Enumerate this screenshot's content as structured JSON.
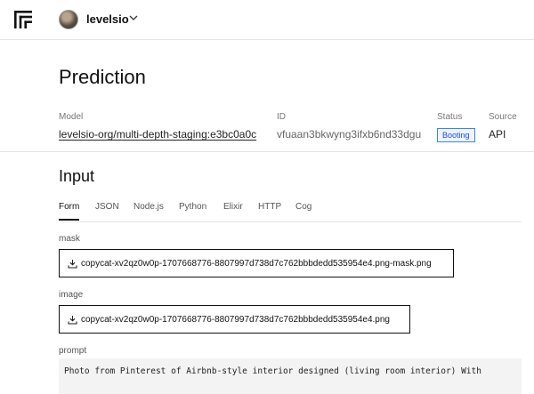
{
  "header": {
    "username": "levelsio",
    "logo_icon": "replicate-logo-icon",
    "menu_icon": "chevron-down-icon"
  },
  "page_title": "Prediction",
  "meta": {
    "model_label": "Model",
    "model_value": "levelsio-org/multi-depth-staging:e3bc0a0c",
    "id_label": "ID",
    "id_value": "vfuaan3bkwyng3ifxb6nd33dgu",
    "status_label": "Status",
    "status_value": "Booting",
    "source_label": "Source",
    "source_value": "API"
  },
  "input": {
    "section_title": "Input",
    "tabs": [
      {
        "label": "Form",
        "active": true
      },
      {
        "label": "JSON",
        "active": false
      },
      {
        "label": "Node.js",
        "active": false
      },
      {
        "label": "Python",
        "active": false
      },
      {
        "label": "Elixir",
        "active": false
      },
      {
        "label": "HTTP",
        "active": false
      },
      {
        "label": "Cog",
        "active": false
      }
    ],
    "fields": {
      "mask_label": "mask",
      "mask_file": "copycat-xv2qz0w0p-1707668776-8807997d738d7c762bbbdedd535954e4.png-mask.png",
      "image_label": "image",
      "image_file": "copycat-xv2qz0w0p-1707668776-8807997d738d7c762bbbdedd535954e4.png",
      "prompt_label": "prompt",
      "prompt_value": "Photo from Pinterest of Airbnb-style interior designed (living room interior) With"
    }
  },
  "colors": {
    "badge_border": "#3b82f6",
    "badge_text": "#1d4ed8",
    "badge_bg": "#eef3ff"
  }
}
